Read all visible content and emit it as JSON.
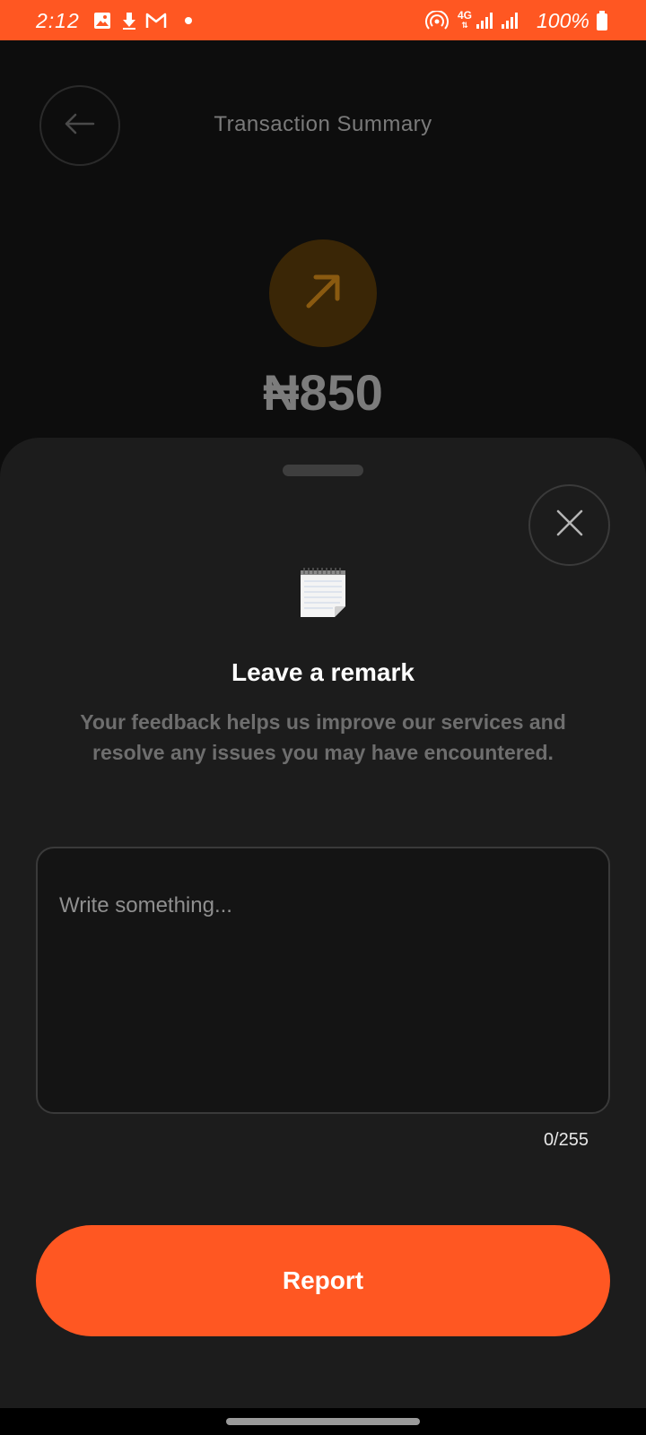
{
  "status_bar": {
    "time": "2:12",
    "battery": "100%",
    "network": "4G",
    "icons": [
      "gallery-icon",
      "download-icon",
      "gmail-icon",
      "dot-icon",
      "hotspot-icon",
      "signal-icon",
      "battery-icon"
    ]
  },
  "background": {
    "title": "Transaction  Summary",
    "amount": "₦850",
    "back_icon": "arrow-left-icon",
    "tx_icon": "arrow-up-right-icon"
  },
  "sheet": {
    "icon": "notepad-icon",
    "title": "Leave a remark",
    "description": "Your feedback helps us improve our services and resolve any issues you may have encountered.",
    "input_placeholder": "Write something...",
    "input_value": "",
    "char_count": "0/255",
    "button_label": "Report"
  },
  "colors": {
    "accent": "#FF5722",
    "sheet_bg": "#1C1C1C",
    "background": "#0D0D0D"
  }
}
